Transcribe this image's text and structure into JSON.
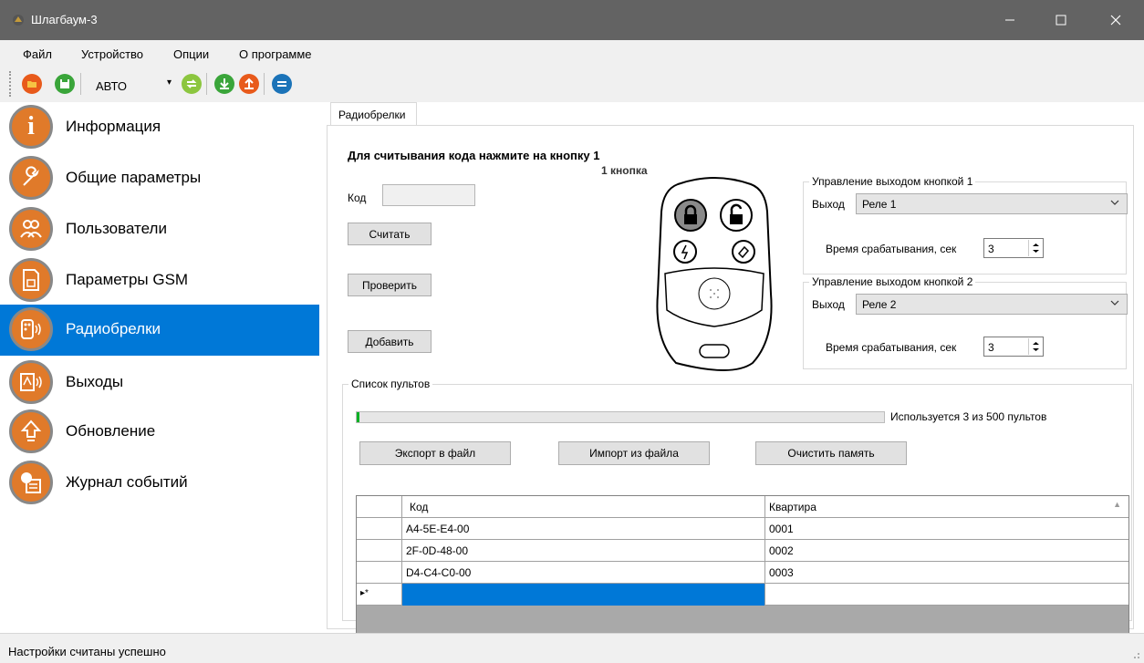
{
  "window": {
    "title": "Шлагбаум-3",
    "minimize_icon": "minimize-icon",
    "maximize_icon": "maximize-icon",
    "close_icon": "close-icon"
  },
  "menu": [
    "Файл",
    "Устройство",
    "Опции",
    "О программе"
  ],
  "toolbar": {
    "mode_value": "АВТО",
    "icons": [
      "open-folder-icon",
      "save-icon",
      "connect-icon",
      "download-icon",
      "upload-icon",
      "sync-icon"
    ]
  },
  "sidebar": {
    "items": [
      {
        "label": "Информация",
        "icon": "info-icon"
      },
      {
        "label": "Общие параметры",
        "icon": "wrench-icon"
      },
      {
        "label": "Пользователи",
        "icon": "users-icon"
      },
      {
        "label": "Параметры GSM",
        "icon": "sim-card-icon"
      },
      {
        "label": "Радиобрелки",
        "icon": "remote-icon",
        "selected": true
      },
      {
        "label": "Выходы",
        "icon": "relay-icon"
      },
      {
        "label": "Обновление",
        "icon": "update-icon"
      },
      {
        "label": "Журнал событий",
        "icon": "event-log-icon"
      }
    ]
  },
  "tab": {
    "label": "Радиобрелки"
  },
  "read": {
    "instruction": "Для считывания кода нажмите на кнопку 1",
    "button_caption": "1 кнопка",
    "code_label": "Код",
    "code_value": "",
    "read_button": "Считать",
    "check_button": "Проверить",
    "add_button": "Добавить"
  },
  "output1": {
    "title": "Управление выходом кнопкой 1",
    "output_label": "Выход",
    "output_value": "Реле 1",
    "time_label": "Время срабатывания, сек",
    "time_value": "3"
  },
  "output2": {
    "title": "Управление выходом кнопкой 2",
    "output_label": "Выход",
    "output_value": "Реле 2",
    "time_label": "Время срабатывания, сек",
    "time_value": "3"
  },
  "remotes": {
    "title": "Список пультов",
    "usage_text": "Используется 3 из 500 пультов",
    "usage_fraction": 0.006,
    "export_button": "Экспорт в файл",
    "import_button": "Импорт из файла",
    "clear_button": "Очистить память",
    "columns": [
      "Код",
      "Квартира"
    ],
    "rows": [
      {
        "code": "A4-5E-E4-00",
        "apartment": "0001"
      },
      {
        "code": "2F-0D-48-00",
        "apartment": "0002"
      },
      {
        "code": "D4-C4-C0-00",
        "apartment": "0003"
      }
    ],
    "new_row_marker": "▸*"
  },
  "status": {
    "text": "Настройки считаны успешно"
  },
  "colors": {
    "accent": "#0078d7",
    "titlebar": "#636363",
    "nav_icon": "#e07a2a"
  }
}
